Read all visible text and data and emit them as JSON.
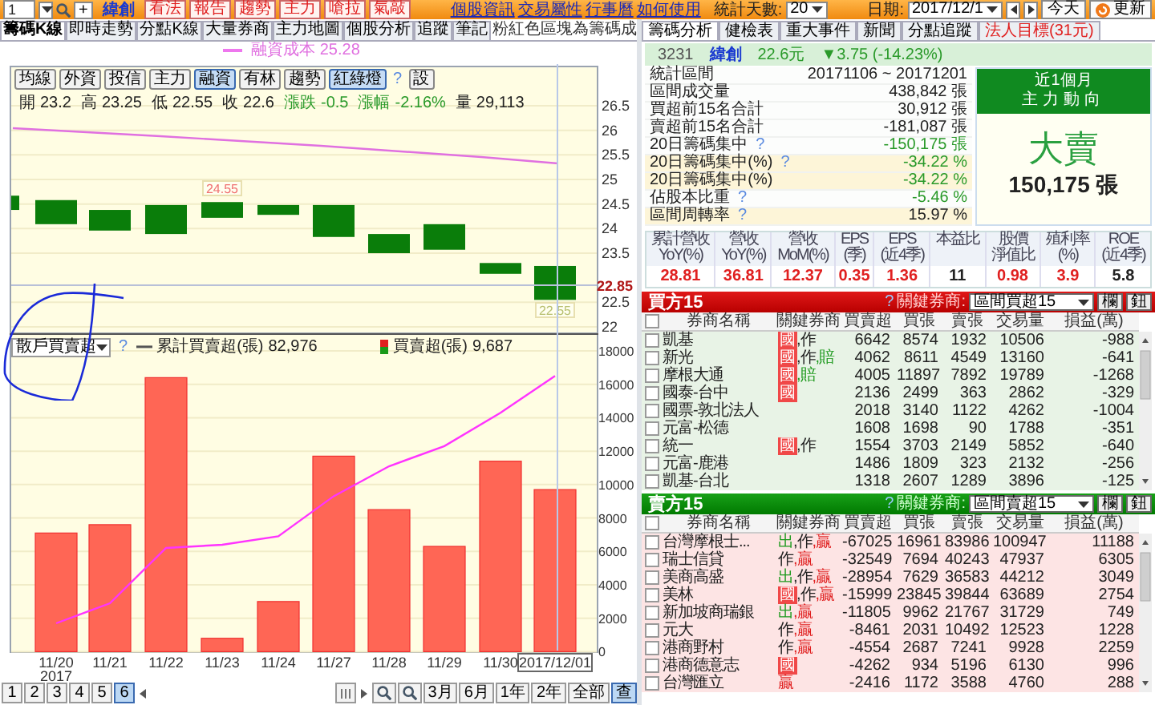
{
  "top_bar": {
    "stock_code": "1",
    "add_button": "+",
    "stock_name": "緯創",
    "action_buttons": [
      "看法",
      "報告",
      "趨勢",
      "主力",
      "嗆拉",
      "氣敲"
    ],
    "links": [
      "個股資訊",
      "交易屬性",
      "行事曆",
      "如何使用"
    ],
    "days_label": "統計天數:",
    "days_value": "20",
    "date_label": "日期:",
    "date_value": "2017/12/1",
    "today_button": "今天",
    "refresh_button": "更新"
  },
  "left_tabs": [
    {
      "label": "籌碼K線",
      "selected": true
    },
    {
      "label": "即時走勢",
      "selected": false
    },
    {
      "label": "分點K線",
      "selected": false
    },
    {
      "label": "大量券商",
      "selected": false
    },
    {
      "label": "主力地圖",
      "selected": false
    },
    {
      "label": "個股分析",
      "selected": false
    },
    {
      "label": "追蹤",
      "selected": false
    },
    {
      "label": "筆記",
      "selected": false
    }
  ],
  "left_note": "粉紅色區塊為籌碼成",
  "price_chart": {
    "legend": "融資成本 25.28",
    "indicator_buttons": [
      {
        "label": "均線",
        "selected": false
      },
      {
        "label": "外資",
        "selected": false
      },
      {
        "label": "投信",
        "selected": false
      },
      {
        "label": "主力",
        "selected": false
      },
      {
        "label": "融資",
        "selected": true
      },
      {
        "label": "有林",
        "selected": false
      },
      {
        "label": "趨勢",
        "selected": false
      },
      {
        "label": "紅綠燈",
        "selected": true
      }
    ],
    "help": "?",
    "settings_button": "設",
    "quote": [
      {
        "label": "開",
        "value": "23.2",
        "kind": "plain"
      },
      {
        "label": "高",
        "value": "23.25",
        "kind": "plain"
      },
      {
        "label": "低",
        "value": "22.55",
        "kind": "plain"
      },
      {
        "label": "收",
        "value": "22.6",
        "kind": "plain"
      },
      {
        "label": "漲跌",
        "value": "-0.5",
        "kind": "down"
      },
      {
        "label": "漲幅",
        "value": "-2.16%",
        "kind": "down"
      },
      {
        "label": "量",
        "value": "29,113",
        "kind": "plain"
      }
    ],
    "yticks": [
      "26.5",
      "26",
      "25.5",
      "25",
      "24.5",
      "24",
      "23.5",
      "22.5",
      "22"
    ],
    "cursor_value": "22.85",
    "high_label": "24.55",
    "low_label": "22.55"
  },
  "flow_chart": {
    "selector": "散戶買賣超",
    "help": "?",
    "line_total": "82,976",
    "bar_total": "9,687",
    "year_label": "2017",
    "chart_data": {
      "type": "bar",
      "grid": true,
      "categories": [
        "11/20",
        "11/21",
        "11/22",
        "11/23",
        "11/24",
        "11/27",
        "11/28",
        "11/29",
        "11/30",
        "2017/12/01"
      ],
      "series": [
        {
          "name": "買賣超(張)",
          "type": "bar",
          "color": "#ff6655",
          "values": [
            7100,
            7600,
            16400,
            800,
            3000,
            11700,
            8500,
            6300,
            11400,
            9700
          ]
        },
        {
          "name": "累計買賣超(張)",
          "type": "line",
          "color": "#ff33ff",
          "values": [
            1700,
            2900,
            6200,
            6400,
            6900,
            9300,
            11100,
            12300,
            14300,
            16500
          ]
        }
      ],
      "ylim": [
        0,
        18000
      ],
      "yticks": [
        0,
        2000,
        4000,
        6000,
        8000,
        10000,
        12000,
        14000,
        16000,
        18000
      ]
    }
  },
  "bottom_bar": {
    "pages": [
      {
        "label": "1",
        "selected": false
      },
      {
        "label": "2",
        "selected": false
      },
      {
        "label": "3",
        "selected": false
      },
      {
        "label": "4",
        "selected": false
      },
      {
        "label": "5",
        "selected": false
      },
      {
        "label": "6",
        "selected": true
      }
    ],
    "ranges": [
      {
        "label": "3月",
        "selected": false
      },
      {
        "label": "6月",
        "selected": false
      },
      {
        "label": "1年",
        "selected": false
      },
      {
        "label": "2年",
        "selected": false
      },
      {
        "label": "全部",
        "selected": false
      },
      {
        "label": "查",
        "selected": true
      }
    ]
  },
  "right_tabs": [
    {
      "label": "籌碼分析",
      "selected": true,
      "kind": "normal"
    },
    {
      "label": "健檢表",
      "selected": false,
      "kind": "normal"
    },
    {
      "label": "重大事件",
      "selected": false,
      "kind": "normal"
    },
    {
      "label": "新聞",
      "selected": false,
      "kind": "normal"
    },
    {
      "label": "分點追蹤",
      "selected": false,
      "kind": "normal"
    },
    {
      "label": "法人目標(31元)",
      "selected": false,
      "kind": "alert"
    }
  ],
  "stock_header": {
    "code": "3231",
    "name": "緯創",
    "price": "22.6元",
    "change": "▼3.75 (-14.23%)"
  },
  "stats": [
    {
      "label": "統計區間",
      "value": "20171106 ~ 20171201",
      "kind": "plain",
      "highlighted": false
    },
    {
      "label": "區間成交量",
      "value": "438,842 張",
      "kind": "plain",
      "highlighted": false
    },
    {
      "label": "買超前15名合計",
      "value": "30,912 張",
      "kind": "plain",
      "highlighted": false
    },
    {
      "label": "賣超前15名合計",
      "value": "-181,087 張",
      "kind": "plain",
      "highlighted": false
    },
    {
      "label": "20日籌碼集中",
      "help": "?",
      "value": "-150,175 張",
      "kind": "down",
      "highlighted": false
    },
    {
      "label": "20日籌碼集中(%)",
      "help": "?",
      "value": "-34.22 %",
      "kind": "down",
      "highlighted": true
    },
    {
      "label": "20日籌碼集中(%)",
      "value": "-34.22 %",
      "kind": "down",
      "highlighted": true
    },
    {
      "label": "佔股本比重",
      "help": "?",
      "value": "-5.46 %",
      "kind": "down",
      "highlighted": false
    },
    {
      "label": "區間周轉率",
      "help": "?",
      "value": "15.97 %",
      "kind": "plain",
      "highlighted": true
    }
  ],
  "trend_box": {
    "period": "近1個月",
    "title": "主力動向",
    "verdict": "大賣",
    "kind": "sell",
    "amount": "150,175 張"
  },
  "metrics": [
    {
      "label": [
        "累計營收",
        "YoY(%)"
      ],
      "value": "28.81",
      "kind": "up"
    },
    {
      "label": [
        "營收",
        "YoY(%)"
      ],
      "value": "36.81",
      "kind": "up"
    },
    {
      "label": [
        "營收",
        "MoM(%)"
      ],
      "value": "12.37",
      "kind": "up"
    },
    {
      "label": [
        "EPS",
        "(季)"
      ],
      "value": "0.35",
      "kind": "up"
    },
    {
      "label": [
        "EPS",
        "(近4季)"
      ],
      "value": "1.36",
      "kind": "up"
    },
    {
      "label": [
        "本益比"
      ],
      "value": "11",
      "kind": "plain"
    },
    {
      "label": [
        "股價",
        "淨值比"
      ],
      "value": "0.98",
      "kind": "up"
    },
    {
      "label": [
        "殖利率",
        "(%)"
      ],
      "value": "3.9",
      "kind": "up"
    },
    {
      "label": [
        "ROE",
        "(近4季)"
      ],
      "value": "5.8",
      "kind": "plain"
    }
  ],
  "tables": [
    {
      "kind": "buy",
      "title": "買方15",
      "help": "?",
      "key_label": "關鍵券商:",
      "select": "區間買超15",
      "buttons": [
        "欄",
        "鈕"
      ],
      "select_all_checked": false,
      "columns": [
        "券商名稱",
        "關鍵券商",
        "買賣超",
        "買張",
        "賣張",
        "交易量",
        "損益(萬)"
      ],
      "rows": [
        {
          "checked": false,
          "broker": "凱基",
          "tags": [
            {
              "text": "國",
              "kind": "badge",
              "color": "#f04848"
            },
            {
              "text": ",作",
              "kind": "text",
              "color": "#222222"
            }
          ],
          "net": "6642",
          "buy": "8574",
          "sell": "1932",
          "volume": "10506",
          "pnl": "-988"
        },
        {
          "checked": false,
          "broker": "新光",
          "tags": [
            {
              "text": "國",
              "kind": "badge",
              "color": "#f04848"
            },
            {
              "text": ",作",
              "kind": "text",
              "color": "#222222"
            },
            {
              "text": ",賠",
              "kind": "text",
              "color": "#1f9a1f"
            }
          ],
          "net": "4062",
          "buy": "8611",
          "sell": "4549",
          "volume": "13160",
          "pnl": "-641"
        },
        {
          "checked": false,
          "broker": "摩根大通",
          "tags": [
            {
              "text": "國",
              "kind": "badge",
              "color": "#f04848"
            },
            {
              "text": ",賠",
              "kind": "text",
              "color": "#1f9a1f"
            }
          ],
          "net": "4005",
          "buy": "11897",
          "sell": "7892",
          "volume": "19789",
          "pnl": "-1268"
        },
        {
          "checked": false,
          "broker": "國泰-台中",
          "tags": [
            {
              "text": "國",
              "kind": "badge",
              "color": "#f04848"
            }
          ],
          "net": "2136",
          "buy": "2499",
          "sell": "363",
          "volume": "2862",
          "pnl": "-329"
        },
        {
          "checked": false,
          "broker": "國票-敦北法人",
          "tags": [],
          "net": "2018",
          "buy": "3140",
          "sell": "1122",
          "volume": "4262",
          "pnl": "-1004"
        },
        {
          "checked": false,
          "broker": "元富-松德",
          "tags": [],
          "net": "1608",
          "buy": "1698",
          "sell": "90",
          "volume": "1788",
          "pnl": "-351"
        },
        {
          "checked": false,
          "broker": "統一",
          "tags": [
            {
              "text": "國",
              "kind": "badge",
              "color": "#f04848"
            },
            {
              "text": ",作",
              "kind": "text",
              "color": "#222222"
            }
          ],
          "net": "1554",
          "buy": "3703",
          "sell": "2149",
          "volume": "5852",
          "pnl": "-640"
        },
        {
          "checked": false,
          "broker": "元富-鹿港",
          "tags": [],
          "net": "1486",
          "buy": "1809",
          "sell": "323",
          "volume": "2132",
          "pnl": "-256"
        },
        {
          "checked": false,
          "broker": "凱基-台北",
          "tags": [],
          "net": "1318",
          "buy": "2607",
          "sell": "1289",
          "volume": "3896",
          "pnl": "-125"
        }
      ]
    },
    {
      "kind": "sell",
      "title": "賣方15",
      "help": "?",
      "key_label": "關鍵券商:",
      "select": "區間賣超15",
      "buttons": [
        "欄",
        "鈕"
      ],
      "select_all_checked": false,
      "columns": [
        "券商名稱",
        "關鍵券商",
        "買賣超",
        "買張",
        "賣張",
        "交易量",
        "損益(萬)"
      ],
      "rows": [
        {
          "checked": false,
          "broker": "台灣摩根士...",
          "tags": [
            {
              "text": "出",
              "kind": "text",
              "color": "#1f9a1f"
            },
            {
              "text": ",作",
              "kind": "text",
              "color": "#222222"
            },
            {
              "text": ",贏",
              "kind": "text",
              "color": "#e02020"
            }
          ],
          "net": "-67025",
          "buy": "16961",
          "sell": "83986",
          "volume": "100947",
          "pnl": "11188"
        },
        {
          "checked": false,
          "broker": "瑞士信貸",
          "tags": [
            {
              "text": "作",
              "kind": "text",
              "color": "#222222"
            },
            {
              "text": ",贏",
              "kind": "text",
              "color": "#e02020"
            }
          ],
          "net": "-32549",
          "buy": "7694",
          "sell": "40243",
          "volume": "47937",
          "pnl": "6305"
        },
        {
          "checked": false,
          "broker": "美商高盛",
          "tags": [
            {
              "text": "出",
              "kind": "text",
              "color": "#1f9a1f"
            },
            {
              "text": ",作",
              "kind": "text",
              "color": "#222222"
            },
            {
              "text": ",贏",
              "kind": "text",
              "color": "#e02020"
            }
          ],
          "net": "-28954",
          "buy": "7629",
          "sell": "36583",
          "volume": "44212",
          "pnl": "3049"
        },
        {
          "checked": false,
          "broker": "美林",
          "tags": [
            {
              "text": "國",
              "kind": "badge",
              "color": "#f04848"
            },
            {
              "text": ",作",
              "kind": "text",
              "color": "#222222"
            },
            {
              "text": ",贏",
              "kind": "text",
              "color": "#e02020"
            }
          ],
          "net": "-15999",
          "buy": "23845",
          "sell": "39844",
          "volume": "63689",
          "pnl": "2754"
        },
        {
          "checked": false,
          "broker": "新加坡商瑞銀",
          "tags": [
            {
              "text": "出",
              "kind": "text",
              "color": "#1f9a1f"
            },
            {
              "text": ",贏",
              "kind": "text",
              "color": "#e02020"
            }
          ],
          "net": "-11805",
          "buy": "9962",
          "sell": "21767",
          "volume": "31729",
          "pnl": "749"
        },
        {
          "checked": false,
          "broker": "元大",
          "tags": [
            {
              "text": "作",
              "kind": "text",
              "color": "#222222"
            },
            {
              "text": ",贏",
              "kind": "text",
              "color": "#e02020"
            }
          ],
          "net": "-8461",
          "buy": "2031",
          "sell": "10492",
          "volume": "12523",
          "pnl": "1228"
        },
        {
          "checked": false,
          "broker": "港商野村",
          "tags": [
            {
              "text": "作",
              "kind": "text",
              "color": "#222222"
            },
            {
              "text": ",贏",
              "kind": "text",
              "color": "#e02020"
            }
          ],
          "net": "-4554",
          "buy": "2687",
          "sell": "7241",
          "volume": "9928",
          "pnl": "2259"
        },
        {
          "checked": false,
          "broker": "港商德意志",
          "tags": [
            {
              "text": "國",
              "kind": "badge",
              "color": "#f04848"
            }
          ],
          "net": "-4262",
          "buy": "934",
          "sell": "5196",
          "volume": "6130",
          "pnl": "996"
        },
        {
          "checked": false,
          "broker": "台灣匯立",
          "tags": [
            {
              "text": "贏",
              "kind": "text",
              "color": "#e02020"
            }
          ],
          "net": "-2416",
          "buy": "1172",
          "sell": "3588",
          "volume": "4760",
          "pnl": "288"
        }
      ]
    }
  ]
}
